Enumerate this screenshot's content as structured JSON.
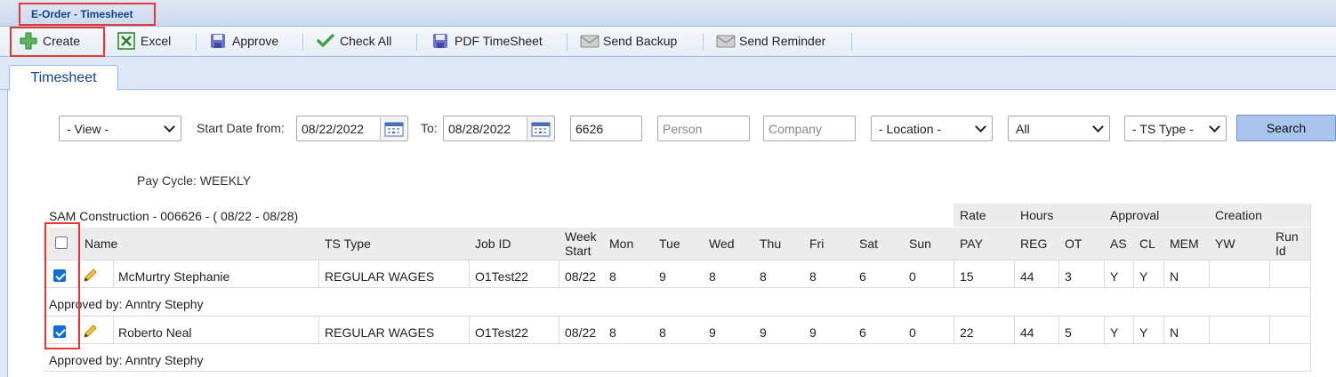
{
  "window": {
    "title": "E-Order - Timesheet"
  },
  "toolbar": {
    "create": "Create",
    "excel": "Excel",
    "approve": "Approve",
    "check_all": "Check All",
    "pdf_timesheet": "PDF TimeSheet",
    "send_backup": "Send Backup",
    "send_reminder": "Send Reminder"
  },
  "tabs": {
    "timesheet": "Timesheet"
  },
  "filters": {
    "view": "- View -",
    "start_label": "Start Date from:",
    "start_date": "08/22/2022",
    "to_label": "To:",
    "end_date": "08/28/2022",
    "code": "6626",
    "person_placeholder": "Person",
    "company_placeholder": "Company",
    "location": "- Location -",
    "status": "All",
    "ts_type": "- TS Type -",
    "search": "Search"
  },
  "pay_cycle": "Pay Cycle: WEEKLY",
  "group_title": "SAM Construction - 006626 - ( 08/22 - 08/28)",
  "group_headers": {
    "rate": "Rate",
    "hours": "Hours",
    "approval": "Approval",
    "creation": "Creation"
  },
  "columns": {
    "name": "Name",
    "ts_type": "TS Type",
    "job_id": "Job ID",
    "week_start_1": "Week",
    "week_start_2": "Start",
    "mon": "Mon",
    "tue": "Tue",
    "wed": "Wed",
    "thu": "Thu",
    "fri": "Fri",
    "sat": "Sat",
    "sun": "Sun",
    "pay": "PAY",
    "reg": "REG",
    "ot": "OT",
    "as": "AS",
    "cl": "CL",
    "mem": "MEM",
    "yw": "YW",
    "run_1": "Run",
    "run_2": "Id"
  },
  "rows": [
    {
      "checked": true,
      "name": "McMurtry Stephanie",
      "ts_type": "REGULAR WAGES",
      "job_id": "O1Test22",
      "week_start": "08/22",
      "mon": "8",
      "tue": "9",
      "wed": "8",
      "thu": "8",
      "fri": "8",
      "sat": "6",
      "sun": "0",
      "pay": "15",
      "reg": "44",
      "ot": "3",
      "as": "Y",
      "cl": "Y",
      "mem": "N",
      "approved_by": "Approved by: Anntry Stephy"
    },
    {
      "checked": true,
      "name": "Roberto Neal",
      "ts_type": "REGULAR WAGES",
      "job_id": "O1Test22",
      "week_start": "08/22",
      "mon": "8",
      "tue": "8",
      "wed": "9",
      "thu": "9",
      "fri": "9",
      "sat": "6",
      "sun": "0",
      "pay": "22",
      "reg": "44",
      "ot": "5",
      "as": "Y",
      "cl": "Y",
      "mem": "N",
      "approved_by": "Approved by: Anntry Stephy"
    }
  ],
  "colors": {
    "highlight": "#e53935",
    "checkbox": "#0f6fd4",
    "header_band": "#ececec",
    "accent": "#15428b"
  },
  "icons": {
    "create": "plus-icon",
    "excel": "excel-icon",
    "approve": "floppy-disk-icon",
    "check_all": "checkmark-icon",
    "pdf": "floppy-disk-icon",
    "send_backup": "envelope-icon",
    "send_reminder": "envelope-icon",
    "calendar": "calendar-icon",
    "edit": "pencil-icon"
  }
}
